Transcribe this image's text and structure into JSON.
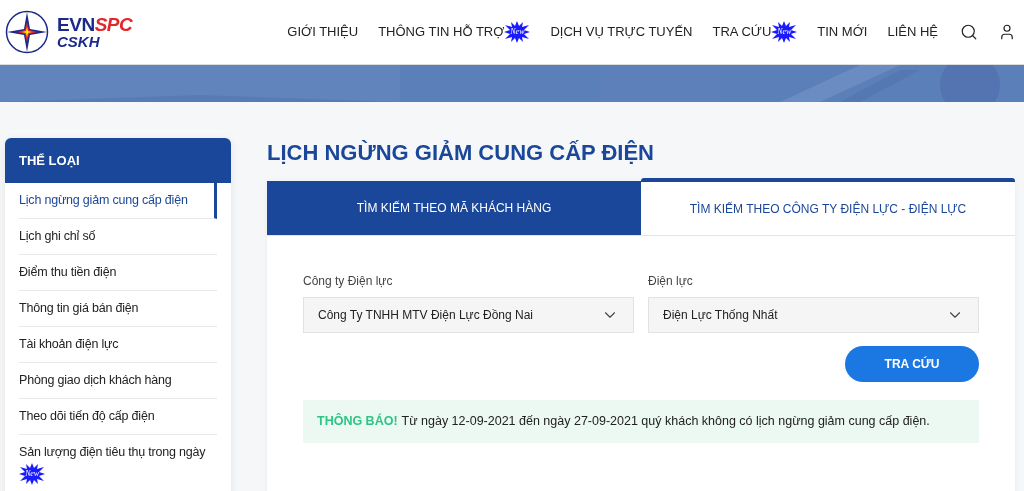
{
  "logo": {
    "brand_1": "EVN",
    "brand_2": "SPC",
    "subtitle": "CSKH"
  },
  "nav": [
    {
      "label": "GIỚI THIỆU"
    },
    {
      "label": "THÔNG TIN HỖ TRỢ",
      "badge": "New"
    },
    {
      "label": "DỊCH VỤ TRỰC TUYẾN"
    },
    {
      "label": "TRA CỨU",
      "badge": "New"
    },
    {
      "label": "TIN MỚI"
    },
    {
      "label": "LIÊN HỆ"
    }
  ],
  "sidebar": {
    "title": "THỂ LOẠI",
    "items": [
      {
        "label": "Lịch ngừng giảm cung cấp điện",
        "selected": true
      },
      {
        "label": "Lịch ghi chỉ số",
        "selected": false
      },
      {
        "label": "Điểm thu tiền điện",
        "selected": false
      },
      {
        "label": "Thông tin giá bán điện",
        "selected": false
      },
      {
        "label": "Tài khoản điện lực",
        "selected": false
      },
      {
        "label": "Phòng giao dịch khách hàng",
        "selected": false
      },
      {
        "label": "Theo dõi tiến độ cấp điện",
        "selected": false
      },
      {
        "label": "Sản lượng điện tiêu thụ trong ngày",
        "selected": false,
        "badge": "New"
      }
    ]
  },
  "page_title": "LỊCH NGỪNG GIẢM CUNG CẤP ĐIỆN",
  "tabs": [
    {
      "label": "TÌM KIẾM THEO MÃ KHÁCH HÀNG",
      "selected": false
    },
    {
      "label": "TÌM KIẾM THEO CÔNG TY ĐIỆN LỰC - ĐIỆN LỰC",
      "selected": true
    }
  ],
  "form": {
    "fields": [
      {
        "label": "Công ty Điện lực",
        "value": "Công Ty TNHH MTV Điện Lực Đồng Nai"
      },
      {
        "label": "Điện lực",
        "value": "Điện Lực Thống Nhất"
      }
    ],
    "button": "TRA CỨU"
  },
  "notice": {
    "label": "THÔNG BÁO!",
    "text": "Từ ngày 12-09-2021 đến ngày 27-09-2021 quý khách không có lịch ngừng giảm cung cấp điện."
  }
}
